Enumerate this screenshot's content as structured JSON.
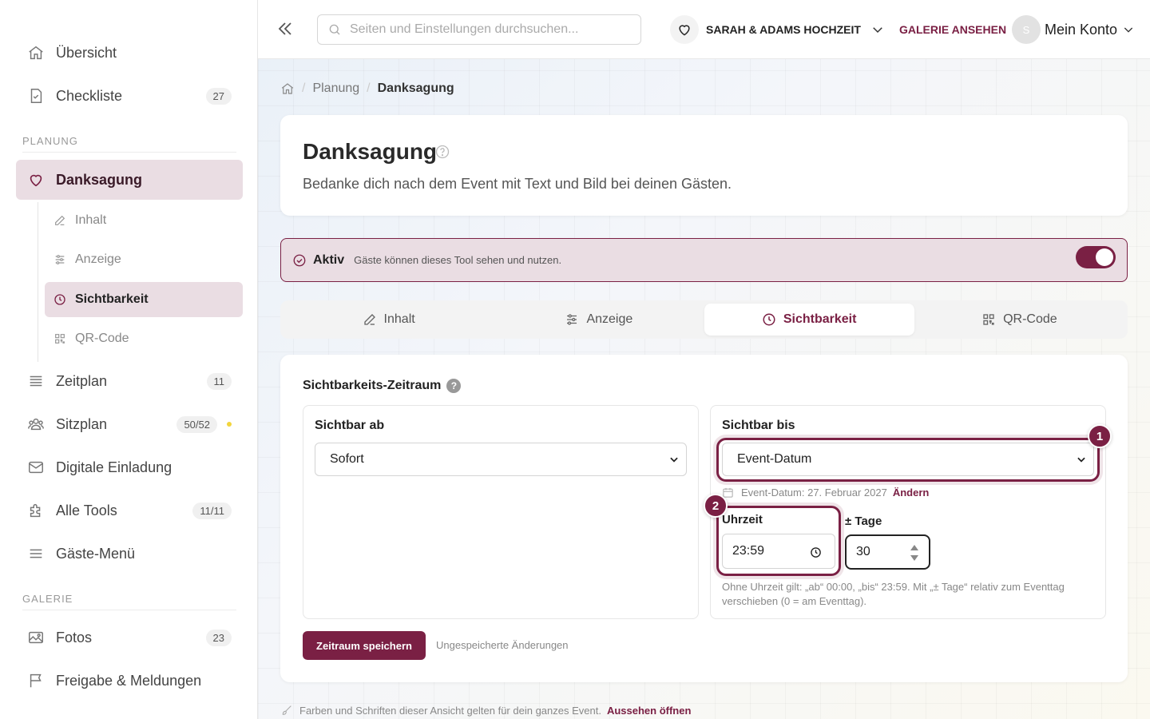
{
  "sidebar": {
    "items": [
      {
        "label": "Übersicht",
        "icon": "home-icon"
      },
      {
        "label": "Checkliste",
        "icon": "checklist-icon",
        "badge": "27"
      }
    ],
    "section_planung": "PLANUNG",
    "danksagung": {
      "label": "Danksagung",
      "icon": "heart-icon",
      "sub": [
        {
          "label": "Inhalt",
          "icon": "edit-icon"
        },
        {
          "label": "Anzeige",
          "icon": "sliders-icon"
        },
        {
          "label": "Sichtbarkeit",
          "icon": "clock-icon"
        },
        {
          "label": "QR-Code",
          "icon": "qr-icon"
        }
      ]
    },
    "items2": [
      {
        "label": "Zeitplan",
        "icon": "list-icon",
        "badge": "11"
      },
      {
        "label": "Sitzplan",
        "icon": "people-icon",
        "badge": "50/52"
      },
      {
        "label": "Digitale Einladung",
        "icon": "mail-icon"
      },
      {
        "label": "Alle Tools",
        "icon": "puzzle-icon",
        "badge": "11/11"
      },
      {
        "label": "Gäste-Menü",
        "icon": "menu-icon"
      }
    ],
    "section_galerie": "GALERIE",
    "items3": [
      {
        "label": "Fotos",
        "icon": "image-icon",
        "badge": "23"
      },
      {
        "label": "Freigabe & Meldungen",
        "icon": "flag-icon"
      }
    ]
  },
  "topbar": {
    "search_placeholder": "Seiten und Einstellungen durchsuchen...",
    "event_name": "SARAH & ADAMS HOCHZEIT",
    "gallery_link": "GALERIE ANSEHEN",
    "avatar_initial": "S",
    "account_label": "Mein Konto"
  },
  "breadcrumb": {
    "parent": "Planung",
    "current": "Danksagung"
  },
  "page": {
    "title": "Danksagung",
    "subtitle": "Bedanke dich nach dem Event mit Text und Bild bei deinen Gästen."
  },
  "status": {
    "label": "Aktiv",
    "text": "Gäste können dieses Tool sehen und nutzen.",
    "enabled": true
  },
  "tabs": [
    {
      "label": "Inhalt",
      "icon": "edit-icon"
    },
    {
      "label": "Anzeige",
      "icon": "sliders-icon"
    },
    {
      "label": "Sichtbarkeit",
      "icon": "clock-icon",
      "active": true
    },
    {
      "label": "QR-Code",
      "icon": "qr-icon"
    }
  ],
  "visibility": {
    "title": "Sichtbarkeits-Zeitraum",
    "help": "?",
    "from": {
      "label": "Sichtbar ab",
      "value": "Sofort"
    },
    "until": {
      "label": "Sichtbar bis",
      "value": "Event-Datum",
      "event_date": "Event-Datum: 27. Februar 2027",
      "change": "Ändern",
      "time_label": "Uhrzeit",
      "time_value": "23:59",
      "days_label": "± Tage",
      "days_value": "30",
      "help": "Ohne Uhrzeit gilt: „ab“ 00:00, „bis“ 23:59. Mit „± Tage“ relativ zum Eventtag verschieben (0 = am Eventtag)."
    },
    "save_label": "Zeitraum speichern",
    "unsaved_label": "Ungespeicherte Änderungen"
  },
  "markers": [
    "1",
    "2"
  ],
  "footer": {
    "note": "Farben und Schriften dieser Ansicht gelten für dein ganzes Event.",
    "link": "Aussehen öffnen"
  },
  "colors": {
    "accent": "#7a2044",
    "accent_soft": "#eadde3"
  }
}
